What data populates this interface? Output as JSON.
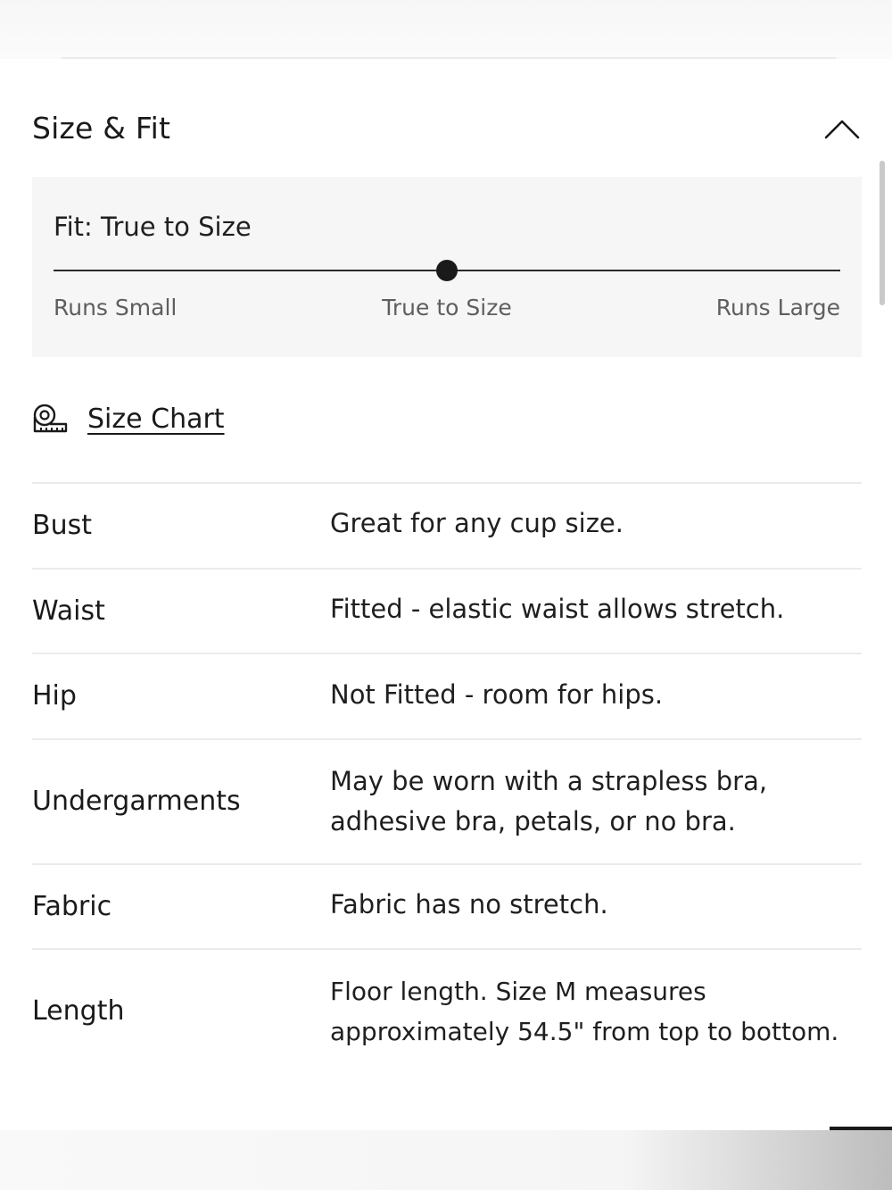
{
  "section": {
    "title": "Size & Fit",
    "collapse_icon": "chevron-up-icon"
  },
  "fit": {
    "title": "Fit: True to Size",
    "scale_position": 0.5,
    "labels": {
      "small": "Runs Small",
      "true": "True to Size",
      "large": "Runs Large"
    }
  },
  "size_chart": {
    "icon": "measuring-tape-icon",
    "label": "Size Chart"
  },
  "specs": [
    {
      "label": "Bust",
      "value": "Great for any cup size."
    },
    {
      "label": "Waist",
      "value": "Fitted - elastic waist allows stretch."
    },
    {
      "label": "Hip",
      "value": "Not Fitted - room for hips."
    },
    {
      "label": "Undergarments",
      "value": "May be worn with a strapless bra, adhesive bra, petals, or no bra."
    },
    {
      "label": "Fabric",
      "value": "Fabric has no stretch."
    },
    {
      "label": "Length",
      "value": "Floor length. Size M measures approximately 54.5\" from top to bottom."
    }
  ]
}
